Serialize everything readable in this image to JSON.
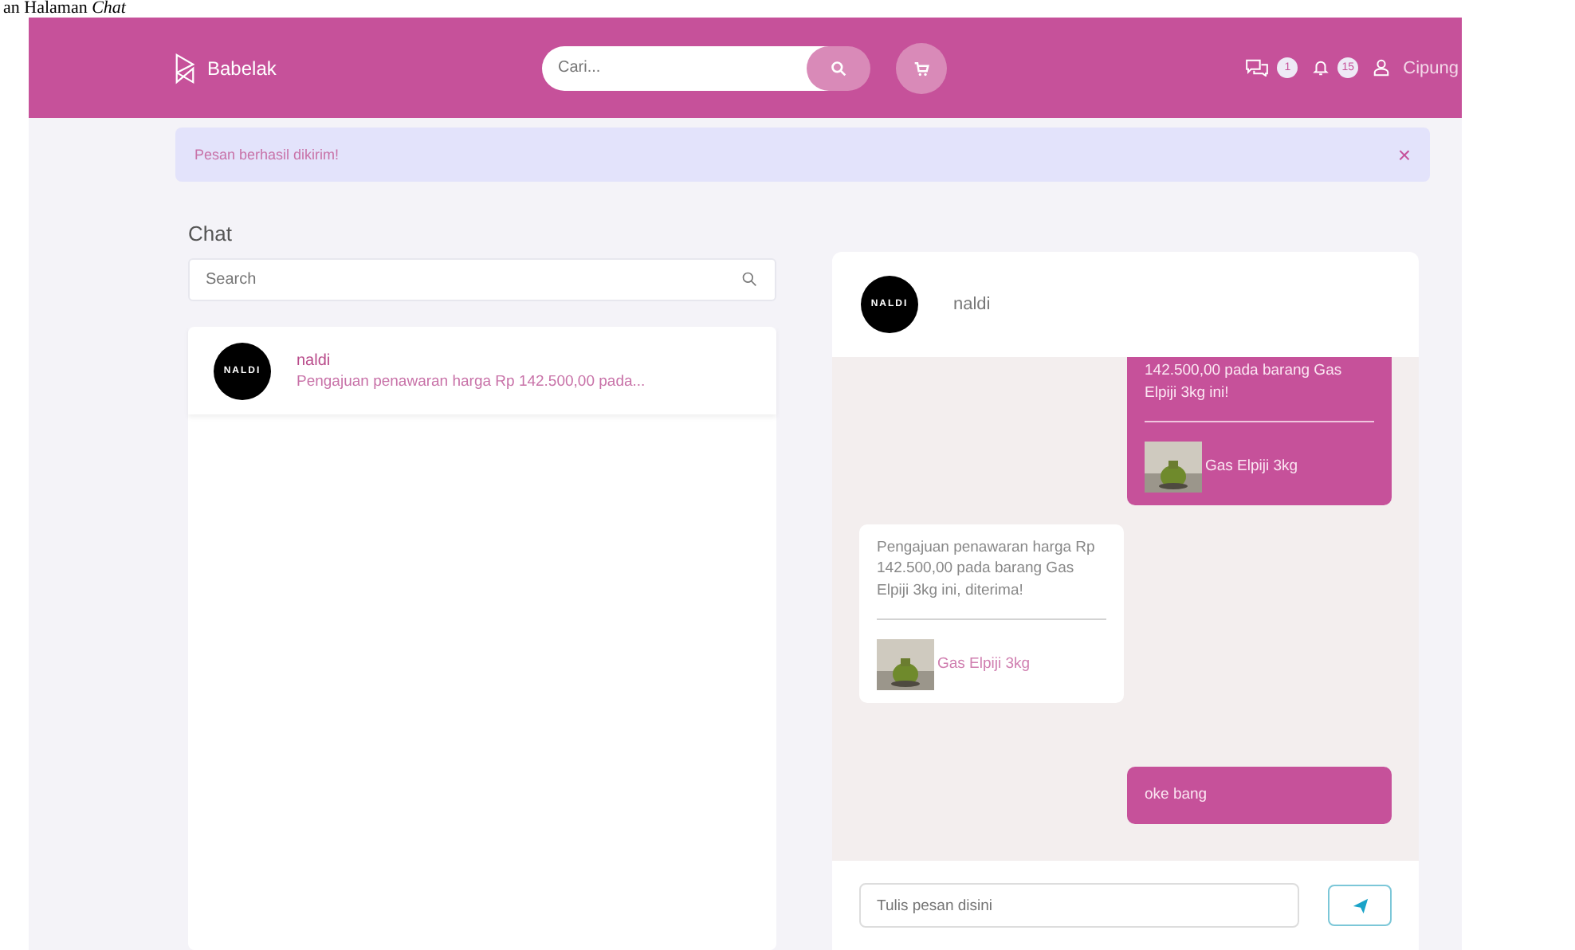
{
  "caption": "an Halaman *Chat*",
  "header": {
    "brand": "Babelak",
    "search_placeholder": "Cari...",
    "chat_badge": "1",
    "notif_badge": "15",
    "user": "Cipung"
  },
  "alert": {
    "text": "Pesan berhasil dikirim!",
    "close": "×"
  },
  "chat_title": "Chat",
  "search": {
    "placeholder": "Search"
  },
  "conversations": [
    {
      "avatar": "NALDI",
      "name": "naldi",
      "preview": "Pengajuan penawaran harga Rp 142.500,00 pada..."
    }
  ],
  "thread": {
    "avatar": "NALDI",
    "name": "naldi",
    "messages": [
      {
        "kind": "offer",
        "sent": true,
        "text": "142.500,00 pada barang Gas Elpiji 3kg ini!",
        "product": "Gas Elpiji 3kg"
      },
      {
        "kind": "offer",
        "sent": false,
        "text": "Pengajuan penawaran harga Rp 142.500,00 pada barang Gas Elpiji 3kg ini, diterima!",
        "product": "Gas Elpiji 3kg"
      },
      {
        "kind": "text",
        "sent": true,
        "text": "oke bang"
      }
    ],
    "input_placeholder": "Tulis pesan disini"
  }
}
